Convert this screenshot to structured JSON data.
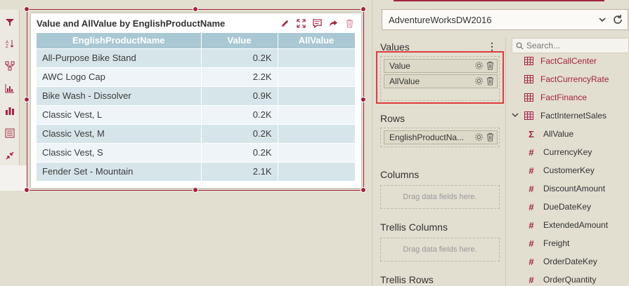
{
  "widget": {
    "title": "Value and AllValue by EnglishProductName",
    "columns": [
      "EnglishProductName",
      "Value",
      "AllValue"
    ],
    "rows": [
      [
        "All-Purpose Bike Stand",
        "0.2K",
        ""
      ],
      [
        "AWC Logo Cap",
        "2.2K",
        ""
      ],
      [
        "Bike Wash - Dissolver",
        "0.9K",
        ""
      ],
      [
        "Classic Vest, L",
        "0.2K",
        ""
      ],
      [
        "Classic Vest, M",
        "0.2K",
        ""
      ],
      [
        "Classic Vest, S",
        "0.2K",
        ""
      ],
      [
        "Fender Set - Mountain",
        "2.1K",
        ""
      ]
    ]
  },
  "datasource": {
    "selected": "AdventureWorksDW2016"
  },
  "sections": {
    "values": "Values",
    "rows": "Rows",
    "columns": "Columns",
    "trellis_columns": "Trellis Columns",
    "trellis_rows": "Trellis Rows",
    "drop_placeholder": "Drag data fields here."
  },
  "values_fields": [
    "Value",
    "AllValue"
  ],
  "rows_fields": [
    "EnglishProductNa..."
  ],
  "search": {
    "placeholder": "Search..."
  },
  "tree": [
    {
      "label": "FactCallCenter",
      "icon": "table-icon"
    },
    {
      "label": "FactCurrencyRate",
      "icon": "table-icon"
    },
    {
      "label": "FactFinance",
      "icon": "table-icon"
    },
    {
      "label": "FactInternetSales",
      "icon": "table-icon"
    },
    {
      "label": "AllValue",
      "icon": "sigma-icon"
    },
    {
      "label": "CurrencyKey",
      "icon": "hash-icon"
    },
    {
      "label": "CustomerKey",
      "icon": "hash-icon"
    },
    {
      "label": "DiscountAmount",
      "icon": "hash-icon"
    },
    {
      "label": "DueDateKey",
      "icon": "hash-icon"
    },
    {
      "label": "ExtendedAmount",
      "icon": "hash-icon"
    },
    {
      "label": "Freight",
      "icon": "hash-icon"
    },
    {
      "label": "OrderDateKey",
      "icon": "hash-icon"
    },
    {
      "label": "OrderQuantity",
      "icon": "hash-icon"
    }
  ],
  "colors": {
    "accent": "#a3243f",
    "header": "#a9c8d3",
    "highlight": "#e03c3c"
  }
}
